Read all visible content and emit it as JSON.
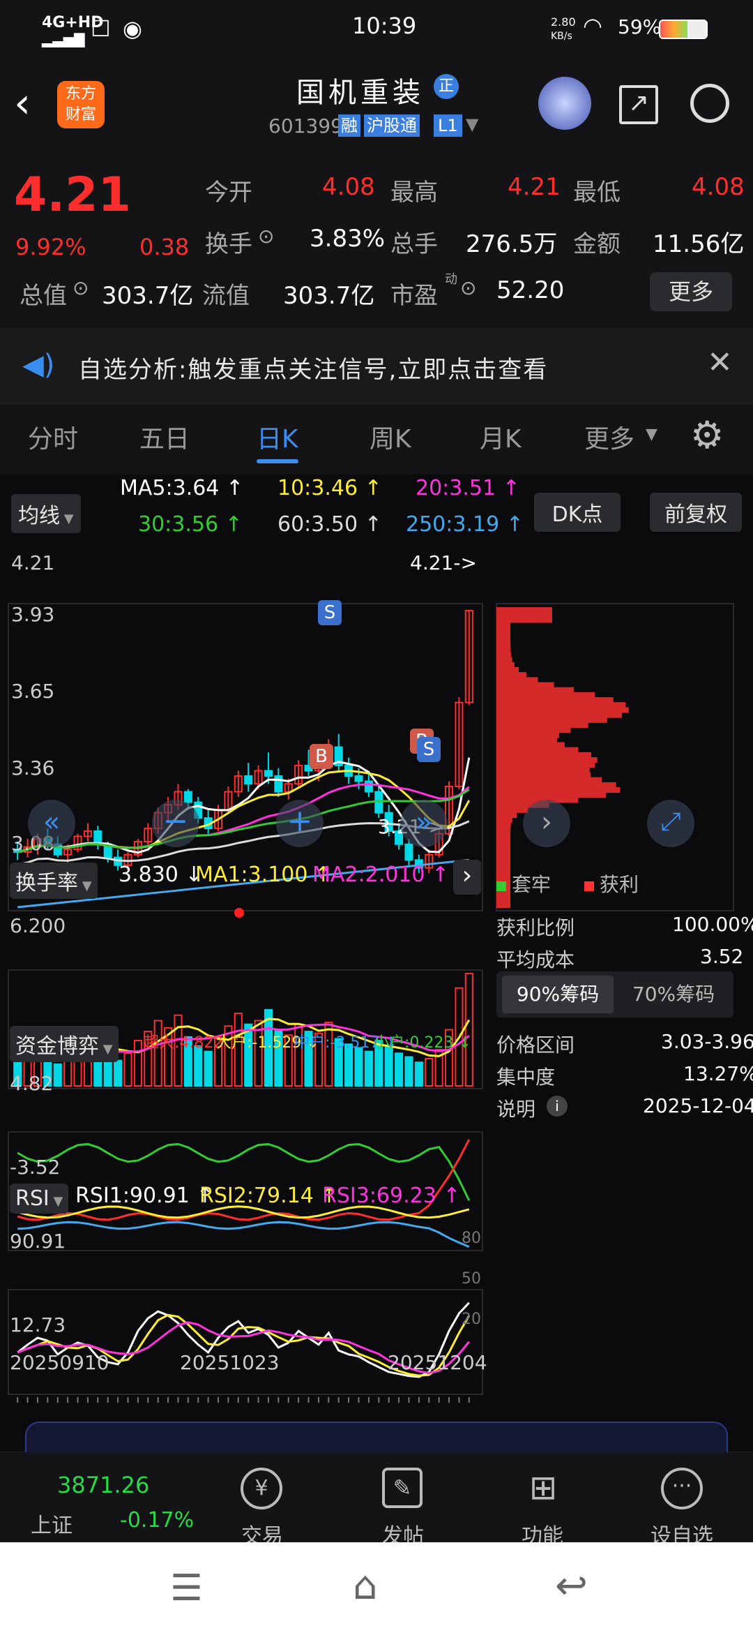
{
  "status": {
    "network": "4G+HD",
    "time": "10:39",
    "speed_top": "2.80",
    "speed_bottom": "KB/s",
    "battery": "59%"
  },
  "header": {
    "logo_top": "东方",
    "logo_bottom": "财富",
    "title": "国机重装",
    "title_badge": "正",
    "code": "601399",
    "tag_rong": "融",
    "tag_hgt": "沪股通",
    "tag_level": "L1"
  },
  "quote": {
    "price": "4.21",
    "pct": "9.92%",
    "chg": "0.38",
    "open_l": "今开",
    "open_v": "4.08",
    "high_l": "最高",
    "high_v": "4.21",
    "low_l": "最低",
    "low_v": "4.08",
    "turn_l": "换手",
    "turn_v": "3.83%",
    "vol_l": "总手",
    "vol_v": "276.5万",
    "amt_l": "金额",
    "amt_v": "11.56亿",
    "mcap_l": "总值",
    "mcap_v": "303.7亿",
    "fcap_l": "流值",
    "fcap_v": "303.7亿",
    "pe_l": "市盈",
    "pe_sup": "动",
    "pe_v": "52.20",
    "more": "更多"
  },
  "notice": {
    "text": "自选分析:触发重点关注信号,立即点击查看"
  },
  "tabs": [
    "分时",
    "五日",
    "日K",
    "周K",
    "月K",
    "更多"
  ],
  "tabs_active": 2,
  "ma": {
    "selector": "均线",
    "ma5": "MA5:3.64",
    "ma10": "10:3.46",
    "ma20": "20:3.51",
    "ma30": "30:3.56",
    "ma60": "60:3.50",
    "ma250": "250:3.19",
    "dk": "DK点",
    "fq": "前复权",
    "arrow": "↑"
  },
  "colors": {
    "up": "#ff2e2e",
    "down": "#00d8e6",
    "ma5": "#ffffff",
    "ma10": "#ffee33",
    "ma20": "#ff33dd",
    "ma30": "#33cc33",
    "ma60": "#dddddd",
    "ma250": "#44aaee"
  },
  "kline": {
    "y_labels": [
      "4.21",
      "3.93",
      "3.65",
      "3.36",
      "3.08"
    ],
    "last_label": "4.21->",
    "low_label": "3.21->",
    "signal_s": "S",
    "signal_b": "B"
  },
  "chart_data": [
    {
      "type": "candlestick",
      "name": "日K",
      "ylim": [
        3.08,
        4.21
      ],
      "candles": [
        [
          3.3,
          3.33,
          3.26,
          3.29
        ],
        [
          3.29,
          3.34,
          3.27,
          3.31
        ],
        [
          3.31,
          3.36,
          3.28,
          3.34
        ],
        [
          3.34,
          3.38,
          3.3,
          3.32
        ],
        [
          3.32,
          3.35,
          3.27,
          3.28
        ],
        [
          3.28,
          3.32,
          3.24,
          3.3
        ],
        [
          3.3,
          3.36,
          3.29,
          3.35
        ],
        [
          3.35,
          3.4,
          3.33,
          3.37
        ],
        [
          3.37,
          3.39,
          3.3,
          3.32
        ],
        [
          3.32,
          3.33,
          3.25,
          3.27
        ],
        [
          3.27,
          3.3,
          3.22,
          3.24
        ],
        [
          3.24,
          3.29,
          3.22,
          3.28
        ],
        [
          3.28,
          3.34,
          3.27,
          3.33
        ],
        [
          3.33,
          3.4,
          3.31,
          3.38
        ],
        [
          3.38,
          3.46,
          3.36,
          3.44
        ],
        [
          3.44,
          3.5,
          3.41,
          3.47
        ],
        [
          3.47,
          3.55,
          3.45,
          3.52
        ],
        [
          3.52,
          3.53,
          3.45,
          3.48
        ],
        [
          3.48,
          3.5,
          3.4,
          3.42
        ],
        [
          3.42,
          3.45,
          3.36,
          3.38
        ],
        [
          3.38,
          3.47,
          3.37,
          3.45
        ],
        [
          3.45,
          3.54,
          3.44,
          3.52
        ],
        [
          3.52,
          3.6,
          3.5,
          3.58
        ],
        [
          3.58,
          3.63,
          3.52,
          3.55
        ],
        [
          3.55,
          3.62,
          3.53,
          3.6
        ],
        [
          3.6,
          3.67,
          3.55,
          3.58
        ],
        [
          3.58,
          3.61,
          3.5,
          3.52
        ],
        [
          3.52,
          3.57,
          3.49,
          3.55
        ],
        [
          3.55,
          3.64,
          3.54,
          3.62
        ],
        [
          3.62,
          3.68,
          3.58,
          3.6
        ],
        [
          3.6,
          3.66,
          3.56,
          3.64
        ],
        [
          3.64,
          3.72,
          3.62,
          3.69
        ],
        [
          3.69,
          3.74,
          3.6,
          3.62
        ],
        [
          3.62,
          3.65,
          3.55,
          3.58
        ],
        [
          3.58,
          3.61,
          3.53,
          3.56
        ],
        [
          3.56,
          3.6,
          3.5,
          3.52
        ],
        [
          3.52,
          3.55,
          3.42,
          3.44
        ],
        [
          3.44,
          3.47,
          3.35,
          3.37
        ],
        [
          3.37,
          3.4,
          3.3,
          3.32
        ],
        [
          3.32,
          3.34,
          3.24,
          3.26
        ],
        [
          3.26,
          3.28,
          3.21,
          3.23
        ],
        [
          3.23,
          3.3,
          3.21,
          3.28
        ],
        [
          3.28,
          3.38,
          3.27,
          3.36
        ],
        [
          3.36,
          3.56,
          3.35,
          3.54
        ],
        [
          3.54,
          3.88,
          3.53,
          3.86
        ],
        [
          3.86,
          4.21,
          3.85,
          4.21
        ]
      ]
    },
    {
      "type": "bar",
      "name": "换手率",
      "label": "换手率",
      "cur": "3.830",
      "ma1": "MA1:3.100",
      "ma2": "MA2:2.010",
      "ymax_label": "6.200",
      "ylim": [
        0,
        6.2
      ],
      "values": [
        2.1,
        1.8,
        2.4,
        1.5,
        1.2,
        1.9,
        2.3,
        2.8,
        2.0,
        1.6,
        1.4,
        1.8,
        2.5,
        3.0,
        3.6,
        3.2,
        3.9,
        2.7,
        2.2,
        1.9,
        2.6,
        3.3,
        4.0,
        3.4,
        3.6,
        4.2,
        3.1,
        2.8,
        3.4,
        3.0,
        2.9,
        3.5,
        2.6,
        2.3,
        2.1,
        1.9,
        2.5,
        2.2,
        1.8,
        1.6,
        1.3,
        1.5,
        2.0,
        3.1,
        5.4,
        6.2
      ]
    },
    {
      "type": "line",
      "name": "资金博弈",
      "label": "资金博弈",
      "super": "超大:4.822",
      "big": "大户:-1.529",
      "mid": "中户:-3.517",
      "small": "小户:0.223",
      "ymax_label": "4.82",
      "ymin_label": "-3.52",
      "ylim": [
        -3.52,
        4.82
      ]
    },
    {
      "type": "line",
      "name": "RSI",
      "label": "RSI",
      "rsi1": "RSI1:90.91",
      "rsi2": "RSI2:79.14",
      "rsi3": "RSI3:69.23",
      "ymax_label": "90.91",
      "ymin_label": "12.73",
      "ylim": [
        12.73,
        90.91
      ],
      "right_ticks": [
        "80",
        "50",
        "20"
      ],
      "x_labels": [
        "20250910",
        "20251023",
        "20251204"
      ],
      "rsi1_values": [
        40,
        48,
        55,
        52,
        38,
        45,
        50,
        47,
        35,
        30,
        28,
        40,
        62,
        75,
        82,
        78,
        70,
        58,
        48,
        40,
        55,
        66,
        72,
        60,
        64,
        58,
        45,
        50,
        62,
        55,
        48,
        60,
        42,
        38,
        36,
        30,
        25,
        20,
        18,
        16,
        15,
        20,
        38,
        62,
        80,
        90.91
      ]
    }
  ],
  "chip": {
    "legend_loss": "套牢",
    "legend_profit": "获利",
    "profit_ratio_l": "获利比例",
    "profit_ratio_v": "100.00%",
    "avg_cost_l": "平均成本",
    "avg_cost_v": "3.52",
    "tab90": "90%筹码",
    "tab70": "70%筹码",
    "range_l": "价格区间",
    "range_v": "3.03-3.96",
    "conc_l": "集中度",
    "conc_v": "13.27%",
    "note_l": "说明",
    "note_v": "2025-12-04"
  },
  "bottom": {
    "index_v": "3871.26",
    "index_l": "上证",
    "index_pct": "-0.17%",
    "trade": "交易",
    "post": "发帖",
    "func": "功能",
    "watch": "设自选"
  }
}
